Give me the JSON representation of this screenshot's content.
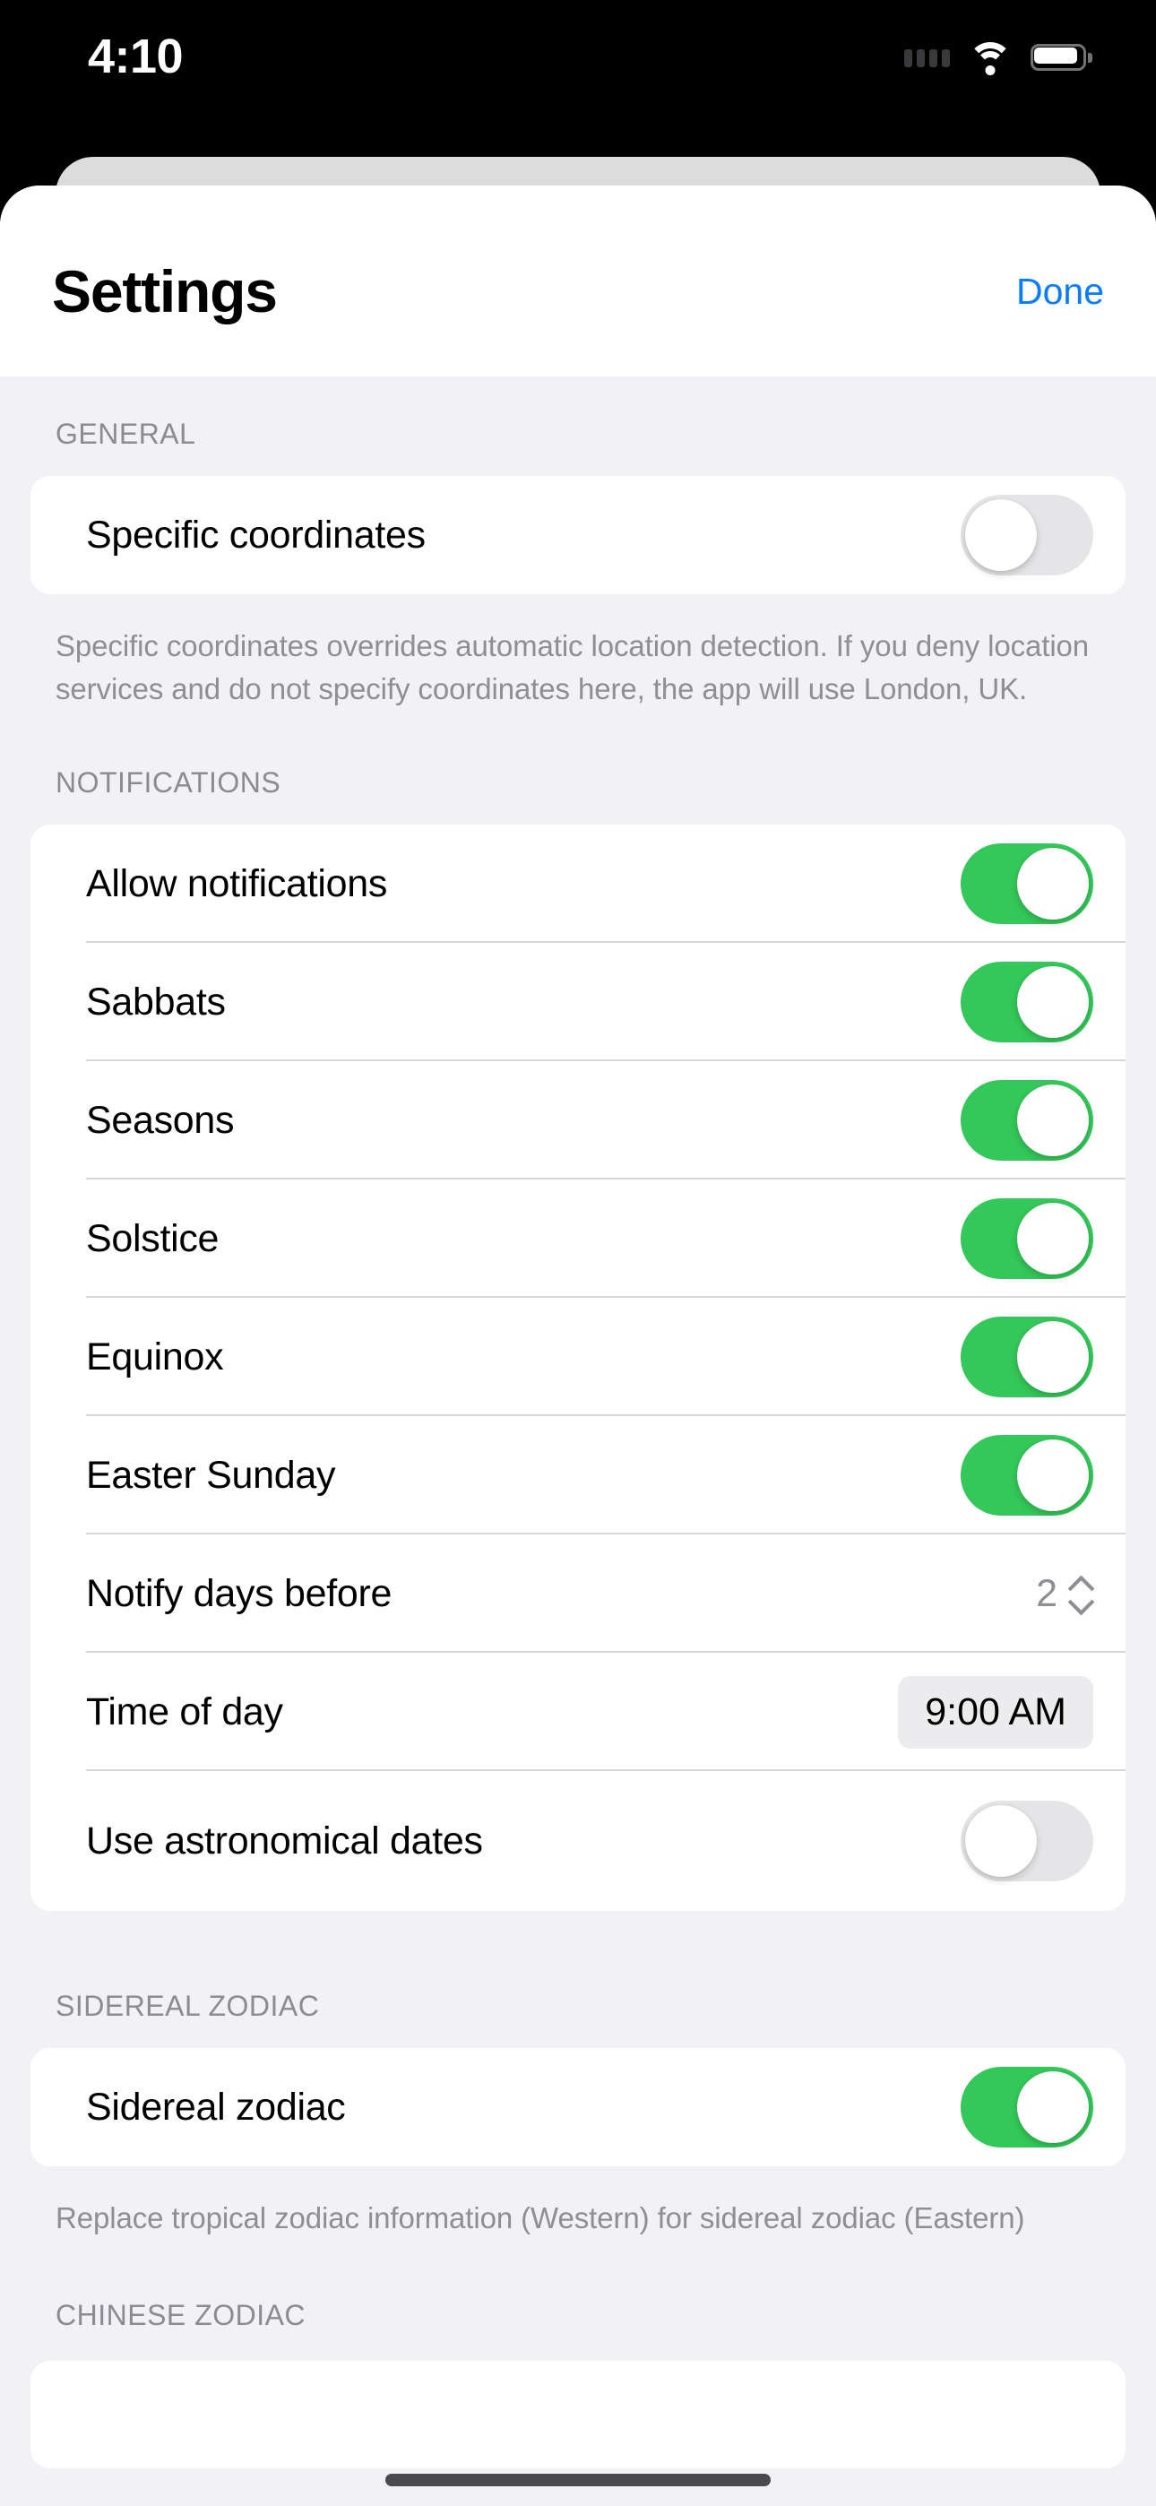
{
  "status_bar": {
    "time": "4:10",
    "cellular_icon": "cellular-dots-icon",
    "wifi_icon": "wifi-icon",
    "battery_icon": "battery-icon"
  },
  "nav": {
    "title": "Settings",
    "done_label": "Done"
  },
  "colors": {
    "accent_blue": "#0a7cff",
    "toggle_on_green": "#34c759",
    "toggle_off_gray": "#e5e5e7",
    "grouped_background": "#f2f1f6",
    "card_background": "#ffffff",
    "secondary_text": "#8e8e93"
  },
  "sections": [
    {
      "header": "GENERAL",
      "rows": [
        {
          "label": "Specific coordinates",
          "control": "toggle",
          "value": "off"
        }
      ],
      "footer": "Specific coordinates overrides automatic location detection. If you deny location services and do not specify coordinates here, the app will use London, UK."
    },
    {
      "header": "NOTIFICATIONS",
      "rows": [
        {
          "label": "Allow notifications",
          "control": "toggle",
          "value": "on"
        },
        {
          "label": "Sabbats",
          "control": "toggle",
          "value": "on"
        },
        {
          "label": "Seasons",
          "control": "toggle",
          "value": "on"
        },
        {
          "label": "Solstice",
          "control": "toggle",
          "value": "on"
        },
        {
          "label": "Equinox",
          "control": "toggle",
          "value": "on"
        },
        {
          "label": "Easter Sunday",
          "control": "toggle",
          "value": "on"
        },
        {
          "label": "Notify days before",
          "control": "stepper",
          "value": "2"
        },
        {
          "label": "Time of day",
          "control": "pill",
          "value": "9:00 AM"
        },
        {
          "label": "Use astronomical dates",
          "control": "toggle",
          "value": "off"
        }
      ],
      "footer": ""
    },
    {
      "header": "SIDEREAL ZODIAC",
      "rows": [
        {
          "label": "Sidereal zodiac",
          "control": "toggle",
          "value": "on"
        }
      ],
      "footer": "Replace tropical zodiac information (Western) for sidereal zodiac (Eastern)"
    },
    {
      "header": "CHINESE ZODIAC",
      "rows": [],
      "footer": ""
    }
  ]
}
